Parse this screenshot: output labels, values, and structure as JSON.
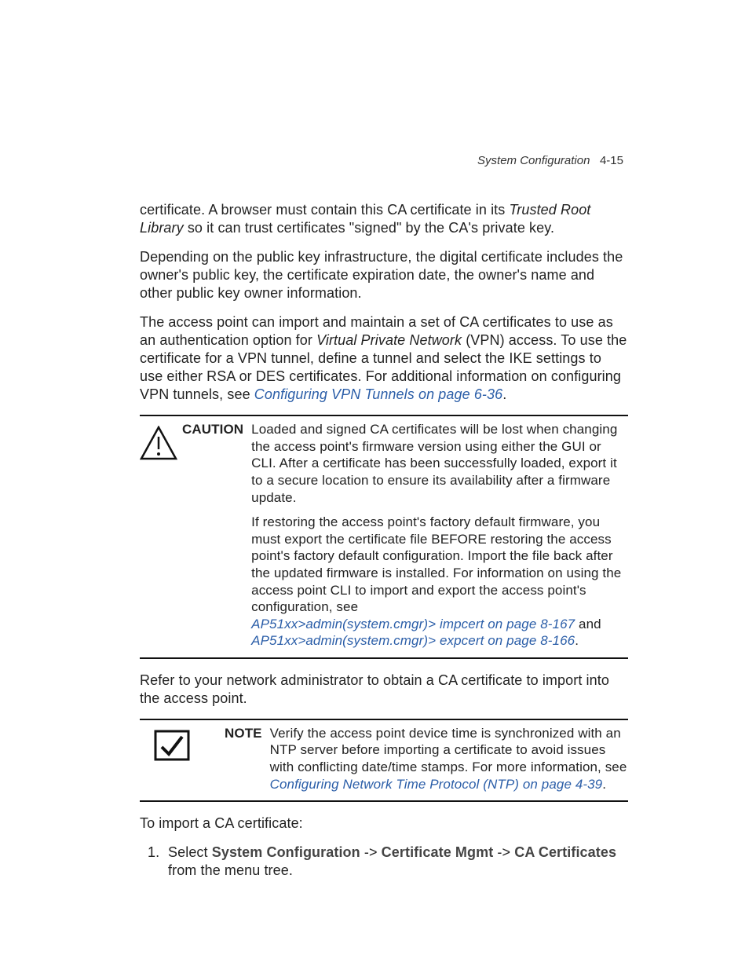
{
  "header": {
    "section": "System Configuration",
    "page": "4-15"
  },
  "p1a": "certificate. A browser must contain this CA certificate in its ",
  "p1b": "Trusted Root Library",
  "p1c": " so it can trust certificates \"signed\" by the CA's private key.",
  "p2": "Depending on the public key infrastructure, the digital certificate includes the owner's public key, the certificate expiration date, the owner's name and other public key owner information.",
  "p3a": "The access point can import and maintain a set of CA certificates to use as an authentication option for ",
  "p3b": "Virtual Private Network",
  "p3c": " (VPN) access. To use the certificate for a VPN tunnel, define a tunnel and select the IKE settings to use either RSA or DES certificates. For additional information on configuring VPN tunnels, see ",
  "p3link": "Configuring VPN Tunnels on page 6-36",
  "caution": {
    "label": "CAUTION",
    "body1": "Loaded and signed CA certificates will be lost when changing the access point's firmware version using either the GUI or CLI. After a certificate has been successfully loaded, export it to a secure location to ensure its availability after a firmware update.",
    "body2": "If restoring the access point's factory default firmware, you must export the certificate file BEFORE restoring the access point's factory default configuration. Import the file back after the updated firmware is installed. For information on using the access point CLI to import and export the access point's configuration, see ",
    "link1": "AP51xx>admin(system.cmgr)> impcert on page 8-167",
    "mid": " and ",
    "link2": "AP51xx>admin(system.cmgr)> expcert on page 8-166"
  },
  "p4": "Refer to your network administrator to obtain a CA certificate to import into the access point.",
  "note": {
    "label": "NOTE",
    "body1": "Verify the access point device time is synchronized with an NTP server before importing a certificate to avoid issues with conflicting date/time stamps. For more information, see ",
    "link": "Configuring Network Time Protocol (NTP) on page 4-39"
  },
  "p5": "To import a CA certificate:",
  "step1a": "Select ",
  "step1_sysconf": "System Configuration",
  "step1_arrow": " -> ",
  "step1_certmgmt": "Certificate Mgmt",
  "step1_cacerts": "CA Certificates",
  "step1b": " from the menu tree."
}
